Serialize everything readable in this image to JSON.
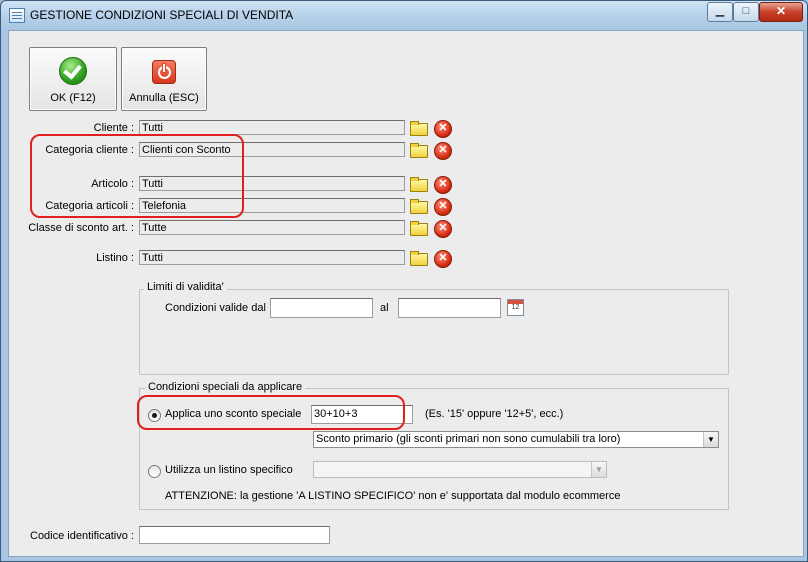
{
  "window": {
    "title": "GESTIONE CONDIZIONI SPECIALI DI VENDITA",
    "minimize_glyph": "▁",
    "maximize_glyph": "□",
    "close_glyph": "✕"
  },
  "toolbar": {
    "ok_label": "OK (F12)",
    "cancel_label": "Annulla (ESC)"
  },
  "filters": {
    "cliente": {
      "label": "Cliente :",
      "value": "Tutti"
    },
    "categoria_cliente": {
      "label": "Categoria cliente :",
      "value": "Clienti con Sconto"
    },
    "articolo": {
      "label": "Articolo :",
      "value": "Tutti"
    },
    "categoria_articoli": {
      "label": "Categoria articoli :",
      "value": "Telefonia"
    },
    "classe_sconto": {
      "label": "Classe di sconto art. :",
      "value": "Tutte"
    },
    "listino": {
      "label": "Listino :",
      "value": "Tutti"
    }
  },
  "clear_glyph": "✕",
  "validity": {
    "title": "Limiti di validita'",
    "from_label": "Condizioni valide dal",
    "from_value": "",
    "to_label": "al",
    "to_value": "",
    "calendar_day": "12"
  },
  "conditions": {
    "title": "Condizioni speciali da applicare",
    "option_discount_label": "Applica uno sconto speciale",
    "discount_value": "30+10+3",
    "discount_hint": "(Es. '15' oppure '12+5', ecc.)",
    "discount_type_selected": "Sconto primario (gli sconti primari non sono cumulabili tra loro)",
    "option_pricelist_label": "Utilizza un listino specifico",
    "pricelist_selected": "",
    "warning": "ATTENZIONE: la gestione 'A LISTINO SPECIFICO' non e' supportata dal modulo ecommerce"
  },
  "identifier": {
    "label": "Codice identificativo :",
    "value": ""
  },
  "colors": {
    "annotation_red": "#e02020",
    "window_blue": "#a8c6e2",
    "panel_gray": "#ececec"
  }
}
